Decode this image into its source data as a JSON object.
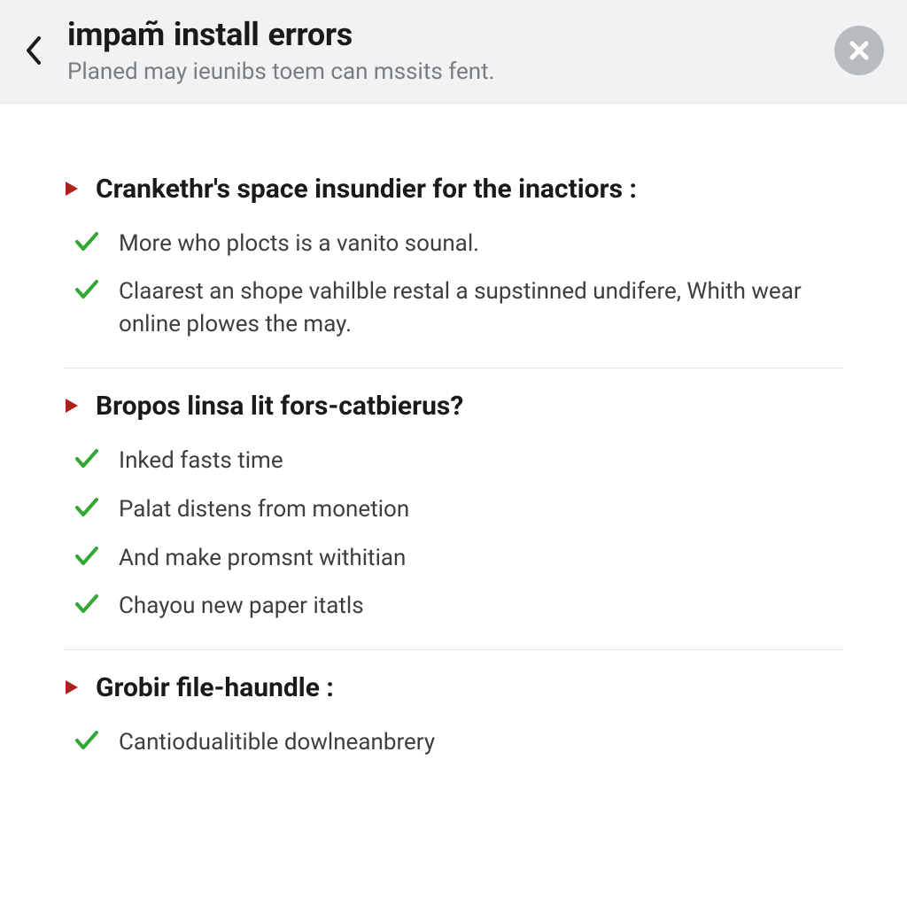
{
  "header": {
    "title_parts": [
      "impam̃",
      "install",
      "errors"
    ],
    "subtitle": "Planed may ieunibs toem can mssits fent."
  },
  "sections": [
    {
      "title": "Crankethr's space insundier for the inactiors :",
      "items": [
        "More who plocts is a vanito sounal.",
        "Claarest an shope vahilble restal a supstinned undifere, Whith wear online plowes the may."
      ]
    },
    {
      "title": "Bropos linsa lit fors-catbierus?",
      "items": [
        "Inked fasts time",
        "Palat distens from monetion",
        "And make promsnt withitian",
        "Chayou new paper itatls"
      ]
    },
    {
      "title": "Grobir file-haundle :",
      "items": [
        "Cantiodualitible dowlneanbrery"
      ]
    }
  ],
  "colors": {
    "accent_red": "#b71c1c",
    "accent_green": "#33a733",
    "close_bg": "#b9bcbf",
    "close_x": "#ffffff"
  }
}
